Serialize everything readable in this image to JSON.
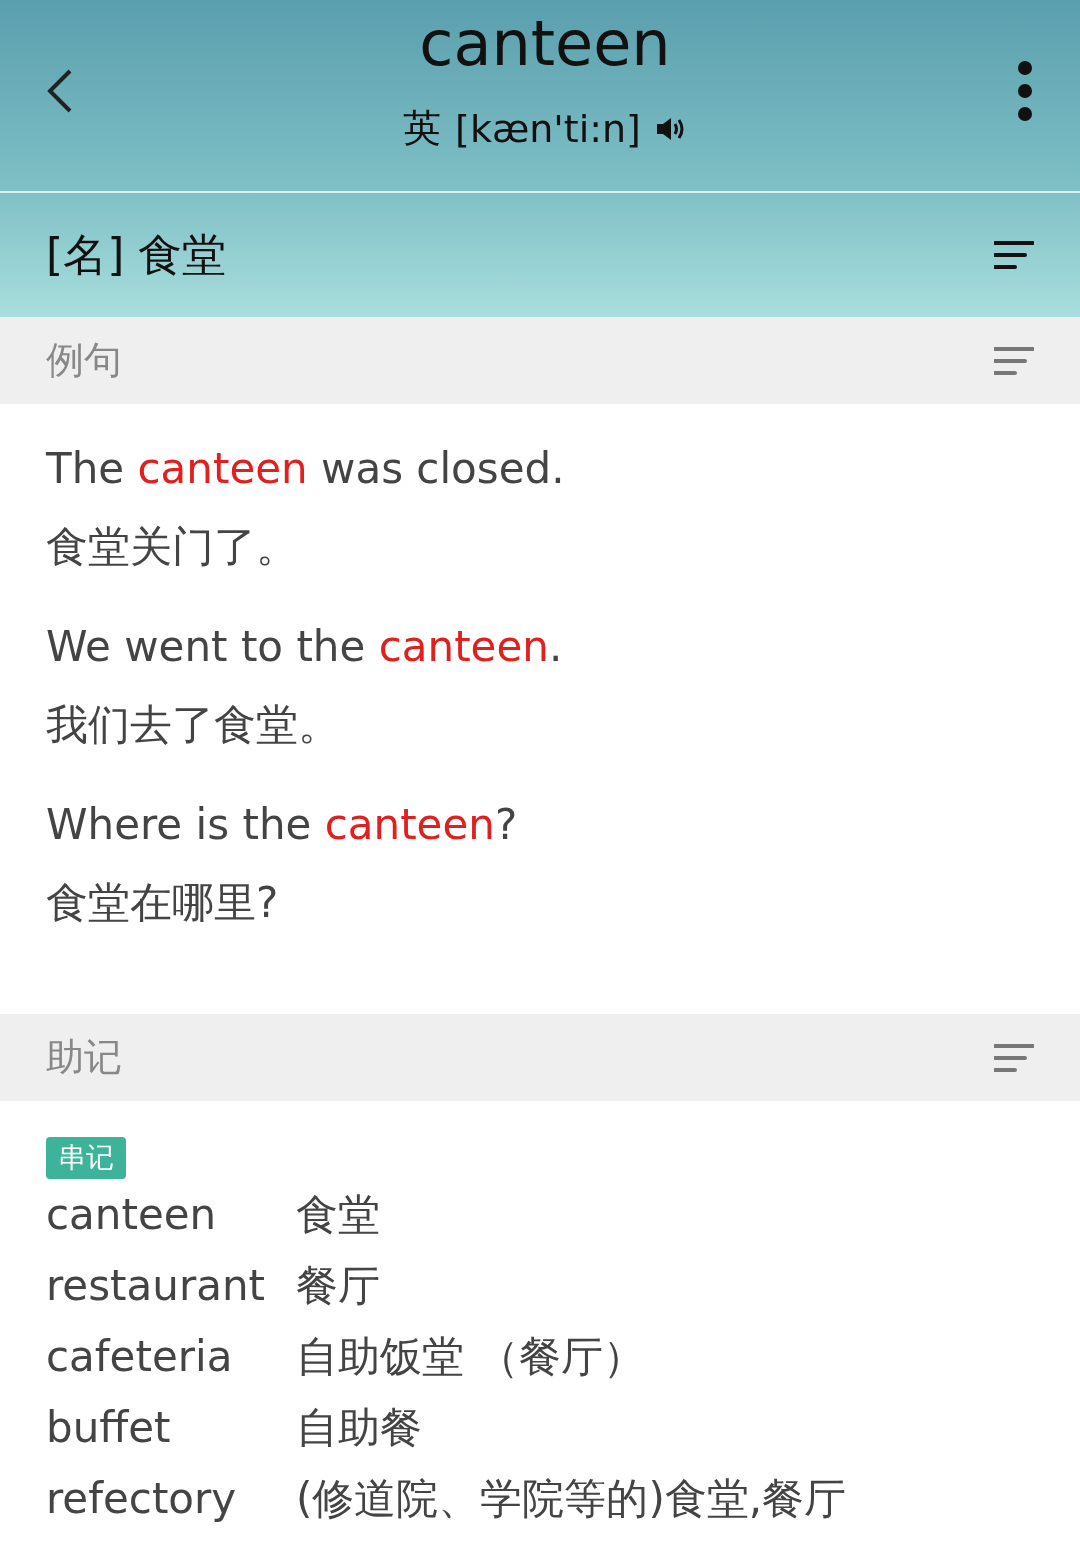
{
  "header": {
    "word": "canteen",
    "accent": "英",
    "phonetic": "[kæn'ti:n]"
  },
  "definition": {
    "text": "[名] 食堂"
  },
  "sections": [
    {
      "title": "例句",
      "kind": "examples",
      "examples": [
        {
          "before": "The ",
          "highlight": "canteen",
          "after": " was closed.",
          "translation": "食堂关门了。"
        },
        {
          "before": "We went to the ",
          "highlight": "canteen",
          "after": ".",
          "translation": "我们去了食堂。"
        },
        {
          "before": "Where is the ",
          "highlight": "canteen",
          "after": "?",
          "translation": "食堂在哪里?"
        }
      ]
    },
    {
      "title": "助记",
      "kind": "mnemonic",
      "tag": "串记",
      "words": [
        {
          "word": "canteen",
          "meaning": "食堂"
        },
        {
          "word": "restaurant",
          "meaning": "餐厅"
        },
        {
          "word": "cafeteria",
          "meaning": "自助饭堂 （餐厅）"
        },
        {
          "word": "buffet",
          "meaning": "自助餐"
        },
        {
          "word": "refectory",
          "meaning": "(修道院、学院等的)食堂,餐厅"
        }
      ]
    }
  ]
}
